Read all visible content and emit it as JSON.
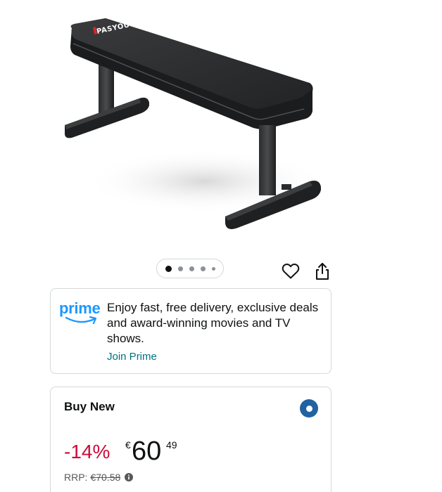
{
  "product": {
    "brand_logo": "PASYOU",
    "image_icon": "flat-bench-image"
  },
  "carousel": {
    "dot_count": 5,
    "active_index": 0
  },
  "actions": {
    "wishlist_icon": "heart-icon",
    "share_icon": "share-icon"
  },
  "prime": {
    "logo": "prime",
    "description": "Enjoy fast, free delivery, exclusive deals and award-winning movies and TV shows.",
    "join_link": "Join Prime"
  },
  "buy_box": {
    "title": "Buy New",
    "selected": true,
    "discount": "-14%",
    "currency": "€",
    "price_whole": "60",
    "price_fraction": "49",
    "rrp_label": "RRP:",
    "rrp_value": "€70.58"
  },
  "colors": {
    "prime_blue": "#1a98ff",
    "link": "#007185",
    "discount_red": "#cc0c39",
    "radio_blue": "#2162a1"
  }
}
